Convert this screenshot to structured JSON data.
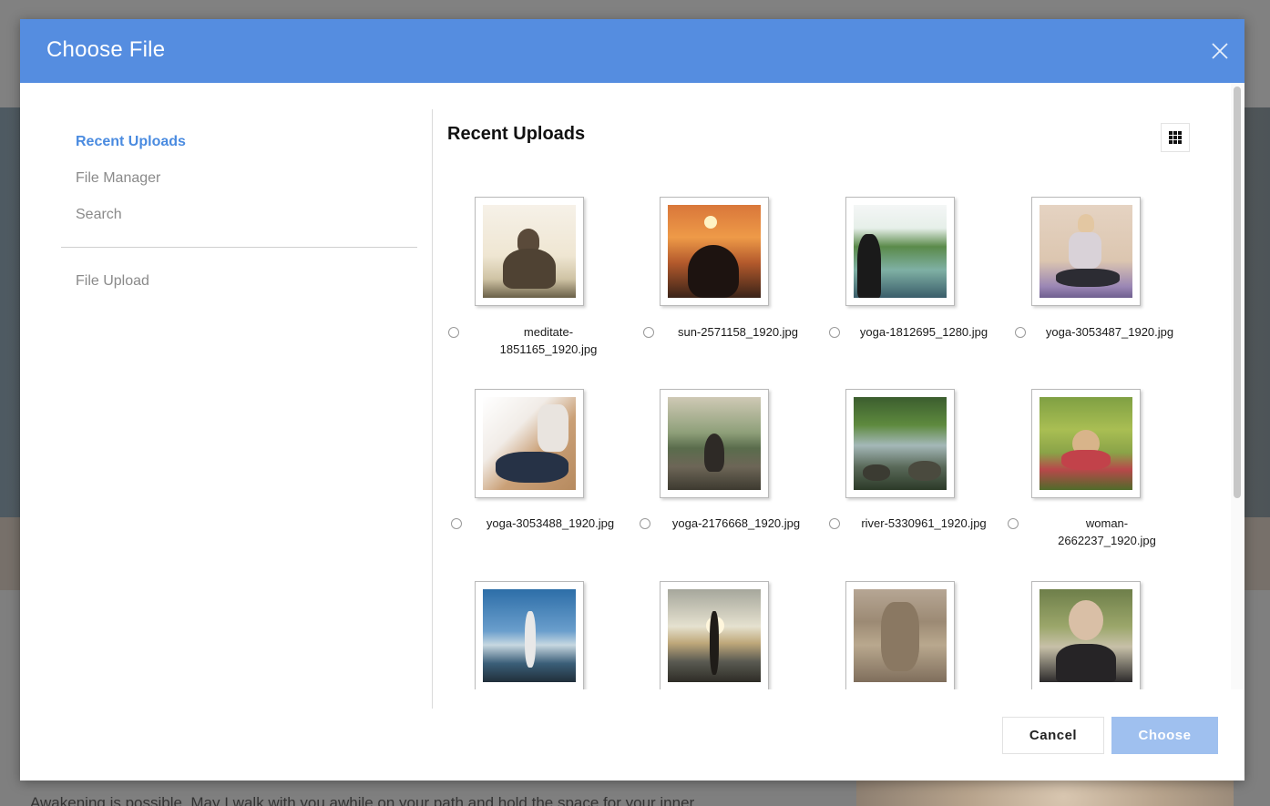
{
  "modal": {
    "title": "Choose File",
    "close_icon": "close-icon",
    "header_color": "#558de0"
  },
  "sidebar": {
    "items": [
      {
        "label": "Recent Uploads",
        "active": true
      },
      {
        "label": "File Manager",
        "active": false
      },
      {
        "label": "Search",
        "active": false
      }
    ],
    "upload_label": "File Upload",
    "active_color": "#4a8be0"
  },
  "main": {
    "title": "Recent Uploads",
    "view_toggle_icon": "grid-icon"
  },
  "files": [
    {
      "name_line1": "meditate-",
      "name_line2": "1851165_1920.jpg"
    },
    {
      "name_line1": "sun-2571158_1920.jpg",
      "name_line2": ""
    },
    {
      "name_line1": "yoga-1812695_1280.jpg",
      "name_line2": ""
    },
    {
      "name_line1": "yoga-3053487_1920.jpg",
      "name_line2": ""
    },
    {
      "name_line1": "yoga-3053488_1920.jpg",
      "name_line2": ""
    },
    {
      "name_line1": "yoga-2176668_1920.jpg",
      "name_line2": ""
    },
    {
      "name_line1": "river-5330961_1920.jpg",
      "name_line2": ""
    },
    {
      "name_line1": "woman-",
      "name_line2": "2662237_1920.jpg"
    },
    {
      "name_line1": "",
      "name_line2": ""
    },
    {
      "name_line1": "",
      "name_line2": ""
    },
    {
      "name_line1": "",
      "name_line2": ""
    },
    {
      "name_line1": "",
      "name_line2": ""
    }
  ],
  "footer": {
    "cancel_label": "Cancel",
    "choose_label": "Choose",
    "choose_color": "#9fc0ef"
  },
  "background_page": {
    "text": "Awakening is possible. May I walk with you awhile on your path and hold the space for your inner"
  }
}
